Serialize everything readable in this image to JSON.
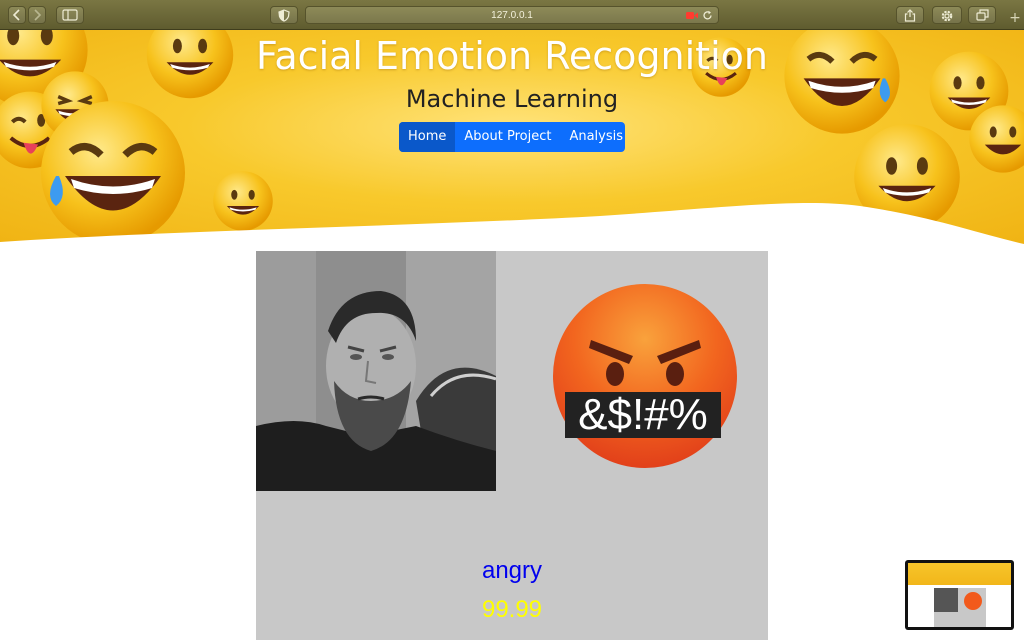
{
  "browser": {
    "url": "127.0.0.1",
    "icons": [
      "chevron-left-icon",
      "chevron-right-icon",
      "sidebar-icon",
      "shield-icon",
      "record-icon",
      "reload-icon",
      "share-icon",
      "gear-icon",
      "tabs-icon",
      "plus-icon"
    ],
    "plus_label": "+"
  },
  "hero": {
    "title": "Facial Emotion Recognition",
    "subtitle": "Machine Learning",
    "nav": [
      {
        "label": "Home",
        "active": true
      },
      {
        "label": "About Project",
        "active": false
      },
      {
        "label": "Analysis",
        "active": false
      }
    ]
  },
  "result": {
    "emotion": "angry",
    "score": "99.99",
    "emoji_text": "&$!#%",
    "colors": {
      "emotion": "#0000ee",
      "score": "#ffff00",
      "panel": "#c8c8c8"
    }
  },
  "colors": {
    "nav": "#0d6efd",
    "banner": "#f8c92c"
  }
}
